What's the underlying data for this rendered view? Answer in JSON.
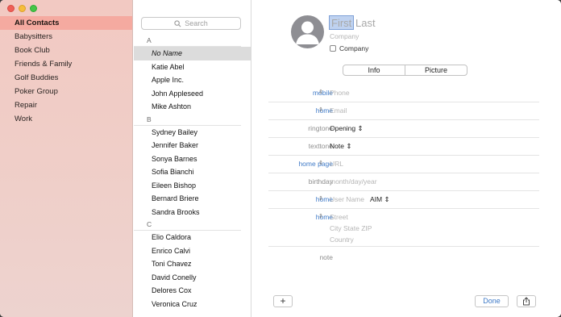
{
  "sidebar": {
    "groups": [
      "All Contacts",
      "Babysitters",
      "Book Club",
      "Friends & Family",
      "Golf Buddies",
      "Poker Group",
      "Repair",
      "Work"
    ]
  },
  "list": {
    "search_placeholder": "Search",
    "sections": {
      "a": {
        "header": "A",
        "contacts": [
          "No Name",
          "Katie Abel",
          "Apple Inc.",
          "John Appleseed",
          "Mike Ashton"
        ]
      },
      "b": {
        "header": "B",
        "contacts": [
          "Sydney Bailey",
          "Jennifer Baker",
          "Sonya Barnes",
          "Sofia Bianchi",
          "Eileen Bishop",
          "Bernard Briere",
          "Sandra Brooks"
        ]
      },
      "c": {
        "header": "C",
        "contacts": [
          "Elio Caldora",
          "Enrico Calvi",
          "Toni Chavez",
          "David Conelly",
          "Delores Cox",
          "Veronica Cruz"
        ]
      }
    }
  },
  "detail": {
    "first_placeholder": "First",
    "last_placeholder": "Last",
    "company_placeholder": "Company",
    "company_checkbox_label": "Company",
    "tabs": [
      "Info",
      "Picture"
    ],
    "fields": {
      "phone": {
        "label": "mobile",
        "value": "Phone"
      },
      "email": {
        "label": "home",
        "value": "Email"
      },
      "ringtone": {
        "label": "ringtone",
        "value": "Opening"
      },
      "texttone": {
        "label": "texttone",
        "value": "Note"
      },
      "homepage": {
        "label": "home page",
        "value": "URL"
      },
      "birthday": {
        "label": "birthday",
        "value": "month/day/year"
      },
      "im": {
        "label": "home",
        "value": "User Name",
        "service": "AIM"
      },
      "address": {
        "label": "home",
        "street": "Street",
        "city_line": "City  State  ZIP",
        "country": "Country"
      },
      "note": {
        "label": "note"
      }
    },
    "add_button": "+",
    "done_button": "Done"
  }
}
